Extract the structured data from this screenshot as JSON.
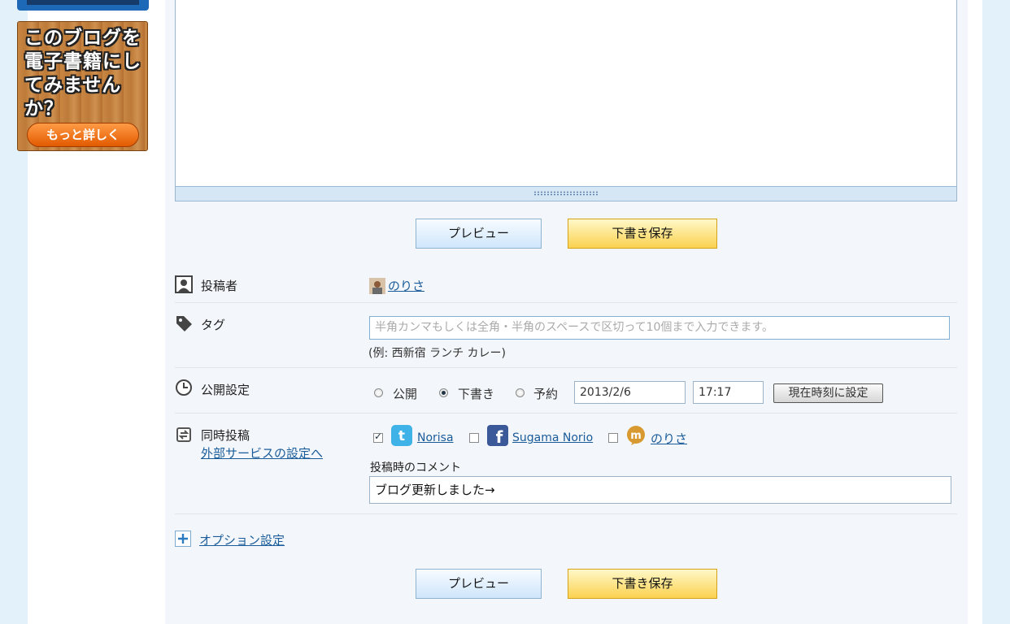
{
  "sidebar": {
    "ebook_banner": {
      "text": "このブログを電子書籍にしてみませんか？",
      "button_label": "もっと詳しく"
    }
  },
  "toolbar": {
    "preview_label": "プレビュー",
    "save_draft_label": "下書き保存"
  },
  "author": {
    "label": "投稿者",
    "name": "のりさ"
  },
  "tags": {
    "label": "タグ",
    "placeholder": "半角カンマもしくは全角・半角のスペースで区切って10個まで入力できます。",
    "example": "(例: 西新宿 ランチ カレー)"
  },
  "publish": {
    "label": "公開設定",
    "options": [
      "公開",
      "下書き",
      "予約"
    ],
    "selected": "下書き",
    "date": "2013/2/6",
    "time": "17:17",
    "now_button": "現在時刻に設定"
  },
  "crosspost": {
    "label": "同時投稿",
    "settings_link": "外部サービスの設定へ",
    "services": [
      {
        "name": "Norisa",
        "icon": "twitter-icon",
        "checked": true
      },
      {
        "name": "Sugama Norio",
        "icon": "facebook-icon",
        "checked": false
      },
      {
        "name": "のりさ",
        "icon": "mixi-icon",
        "checked": false
      }
    ],
    "comment_label": "投稿時のコメント",
    "comment_value": "ブログ更新しました→"
  },
  "options": {
    "label": "オプション設定"
  },
  "colors": {
    "accent": "#1a5c9a",
    "preview_button": "#cfe6fb",
    "draft_button": "#fbd250",
    "twitter": "#3fb3e8",
    "facebook": "#3b5998",
    "mixi": "#d89a30"
  }
}
